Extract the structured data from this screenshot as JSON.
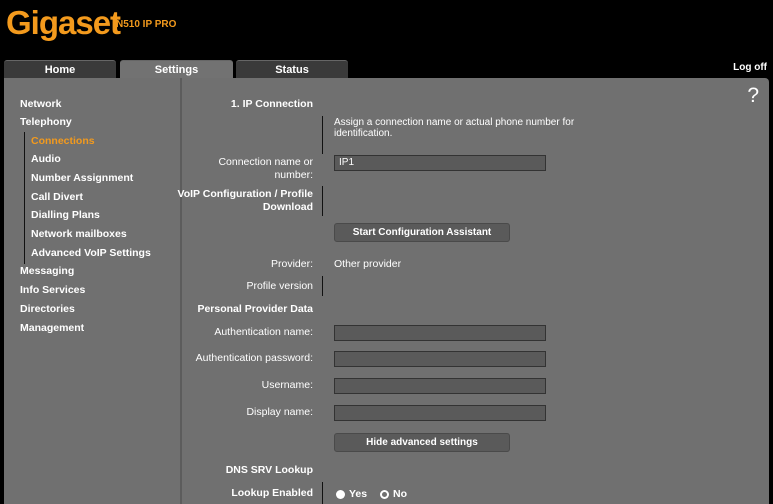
{
  "brand": {
    "name": "Gigaset",
    "model": "N510 IP PRO"
  },
  "tabs": [
    {
      "label": "Home"
    },
    {
      "label": "Settings"
    },
    {
      "label": "Status"
    }
  ],
  "logoff": "Log off",
  "help": "?",
  "sidebar": {
    "items": [
      {
        "label": "Network"
      },
      {
        "label": "Telephony"
      },
      {
        "label": "Connections"
      },
      {
        "label": "Audio"
      },
      {
        "label": "Number Assignment"
      },
      {
        "label": "Call Divert"
      },
      {
        "label": "Dialling Plans"
      },
      {
        "label": "Network mailboxes"
      },
      {
        "label": "Advanced VoIP Settings"
      },
      {
        "label": "Messaging"
      },
      {
        "label": "Info Services"
      },
      {
        "label": "Directories"
      },
      {
        "label": "Management"
      }
    ]
  },
  "form": {
    "section_ip": "1. IP Connection",
    "note": "Assign a connection name or actual phone number for identification.",
    "conn_name_label_1": "Connection name or",
    "conn_name_label_2": "number:",
    "conn_name_value": "IP1",
    "voip_label_1": "VoIP Configuration / Profile",
    "voip_label_2": "Download",
    "start_assistant": "Start Configuration Assistant",
    "provider_label": "Provider:",
    "provider_value": "Other provider",
    "profile_version_label": "Profile version",
    "personal_data": "Personal Provider Data",
    "auth_name_label": "Authentication name:",
    "auth_password_label": "Authentication password:",
    "username_label": "Username:",
    "display_name_label": "Display name:",
    "hide_advanced": "Hide advanced settings",
    "dns_srv": "DNS SRV Lookup",
    "lookup_enabled": "Lookup Enabled",
    "yes": "Yes",
    "no": "No"
  }
}
